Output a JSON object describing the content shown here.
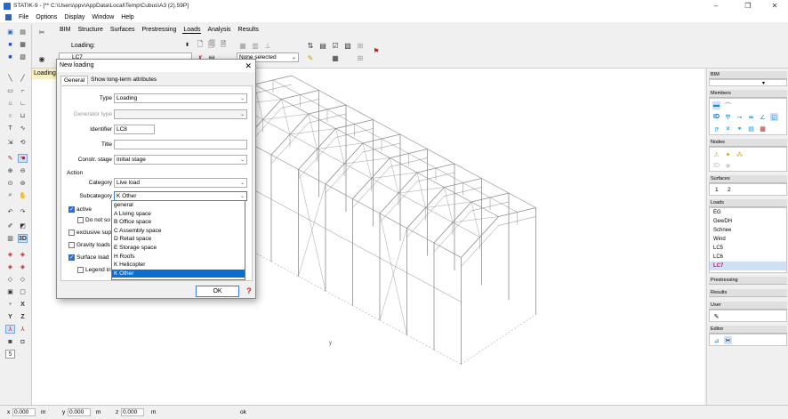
{
  "window": {
    "title": "STATIK-9 - [** C:\\Users\\ppv\\AppData\\Local\\Temp\\Cubus\\A3 (2).59P]",
    "controls": [
      "–",
      "❐",
      "✕"
    ]
  },
  "menu": [
    "File",
    "Options",
    "Display",
    "Window",
    "Help"
  ],
  "ribbon": {
    "tabs": [
      "BIM",
      "Structure",
      "Surfaces",
      "Prestressing",
      "Loads",
      "Analysis",
      "Results"
    ],
    "active_tab": "Loads",
    "loading_label": "Loading:",
    "loading_value": "LC7",
    "none_selected": "None selected"
  },
  "loading_strip": "Loading",
  "dialog": {
    "title": "New loading",
    "tabs": [
      "General",
      "Show long-term attributes"
    ],
    "type_label": "Type",
    "type_value": "Loading",
    "generator_label": "Generator type",
    "generator_value": "",
    "identifier_label": "Identifier",
    "identifier_value": "LC8",
    "title_label": "Title",
    "title_value": "",
    "constr_label": "Constr. stage",
    "constr_value": "Initial stage",
    "action_label": "Action",
    "category_label": "Category",
    "category_value": "Live load",
    "subcategory_label": "Subcategory",
    "subcategory_value": "K Other",
    "active_label": "active",
    "do_not_label": "Do not so",
    "exclusive_label": "exclusive supe",
    "gravity_label": "Gravity loads",
    "surface_label": "Surface load",
    "legend_label": "Legend in",
    "ok_label": "OK",
    "help_label": "?",
    "subcategory_options": [
      "general",
      "A Living space",
      "B Office space",
      "C Assembly space",
      "D Retail space",
      "E Storage space",
      "H Roofs",
      "K Helicopter",
      "K Other"
    ]
  },
  "right_panel": {
    "bim": "BIM",
    "members": "Members",
    "nodes": "Nodes",
    "surfaces": "Surfaces",
    "surfaces_items": [
      "1",
      "2"
    ],
    "loads": "Loads",
    "loads_items": [
      "EG",
      "GewDH",
      "Schnee",
      "Wind",
      "LC5",
      "LC6",
      "LC7"
    ],
    "loads_selected": "LC7",
    "prestressing": "Prestressing",
    "results": "Results",
    "user": "User",
    "editor": "Editor"
  },
  "status": {
    "x_label": "x",
    "x_value": "0.000",
    "x_unit": "m",
    "y_label": "y",
    "y_value": "0.000",
    "y_unit": "m",
    "z_label": "z",
    "z_value": "0.000",
    "z_unit": "m",
    "message": "ok"
  },
  "canvas": {
    "axis_label": "y"
  }
}
